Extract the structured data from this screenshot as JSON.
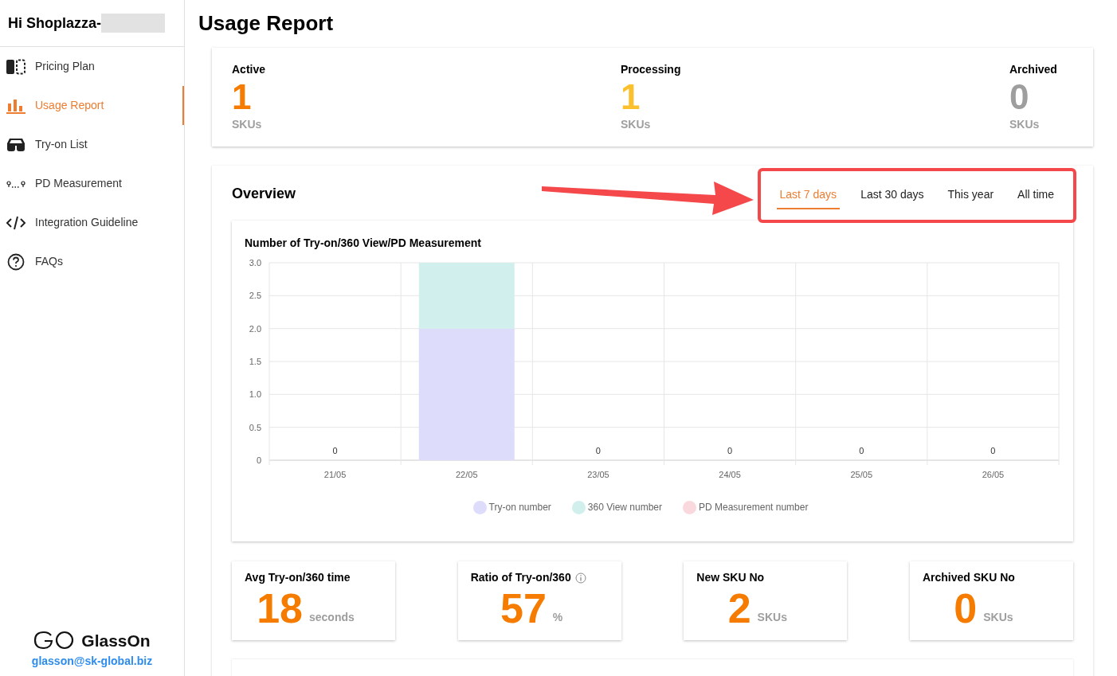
{
  "sidebar": {
    "greeting": "Hi Shoplazza-",
    "items": [
      {
        "label": "Pricing Plan",
        "selected": false
      },
      {
        "label": "Usage Report",
        "selected": true
      },
      {
        "label": "Try-on List",
        "selected": false
      },
      {
        "label": "PD Measurement",
        "selected": false
      },
      {
        "label": "Integration Guideline",
        "selected": false
      },
      {
        "label": "FAQs",
        "selected": false
      }
    ],
    "brand": "GlassOn",
    "email": "glasson@sk-global.biz"
  },
  "page_title": "Usage Report",
  "status_cards": [
    {
      "label": "Active",
      "value": "1",
      "unit": "SKUs",
      "color": "#f57c00"
    },
    {
      "label": "Processing",
      "value": "1",
      "unit": "SKUs",
      "color": "#fbc02d"
    },
    {
      "label": "Archived",
      "value": "0",
      "unit": "SKUs",
      "color": "#9e9e9e"
    }
  ],
  "overview": {
    "title": "Overview",
    "tabs": [
      {
        "label": "Last 7 days",
        "selected": true
      },
      {
        "label": "Last 30 days",
        "selected": false
      },
      {
        "label": "This year",
        "selected": false
      },
      {
        "label": "All time",
        "selected": false
      }
    ],
    "chart_data": {
      "type": "bar",
      "title": "Number of Try-on/360 View/PD Measurement",
      "stacked": true,
      "categories": [
        "21/05",
        "22/05",
        "23/05",
        "24/05",
        "25/05",
        "26/05"
      ],
      "series": [
        {
          "name": "Try-on number",
          "color": "#dedcfb",
          "values": [
            0,
            2,
            0,
            0,
            0,
            0
          ]
        },
        {
          "name": "360 View number",
          "color": "#d1efec",
          "values": [
            0,
            1,
            0,
            0,
            0,
            0
          ]
        },
        {
          "name": "PD Measurement number",
          "color": "#f9d9de",
          "values": [
            0,
            0,
            0,
            0,
            0,
            0
          ]
        }
      ],
      "ylim": [
        0,
        3
      ],
      "yticks": [
        {
          "value": 0,
          "label": "0"
        },
        {
          "value": 0.5,
          "label": "0.5"
        },
        {
          "value": 1,
          "label": "1.0"
        },
        {
          "value": 1.5,
          "label": "1.5"
        },
        {
          "value": 2,
          "label": "2.0"
        },
        {
          "value": 2.5,
          "label": "2.5"
        },
        {
          "value": 3,
          "label": "3.0"
        }
      ],
      "value_labels": [
        "0",
        null,
        "0",
        "0",
        "0",
        "0"
      ],
      "grid": true
    },
    "metrics": [
      {
        "label": "Avg Try-on/360 time",
        "value": "18",
        "unit": "seconds",
        "info": false
      },
      {
        "label": "Ratio of Try-on/360",
        "value": "57",
        "unit": "%",
        "info": true
      },
      {
        "label": "New SKU No",
        "value": "2",
        "unit": "SKUs",
        "info": false
      },
      {
        "label": "Archived SKU No",
        "value": "0",
        "unit": "SKUs",
        "info": false
      }
    ]
  }
}
